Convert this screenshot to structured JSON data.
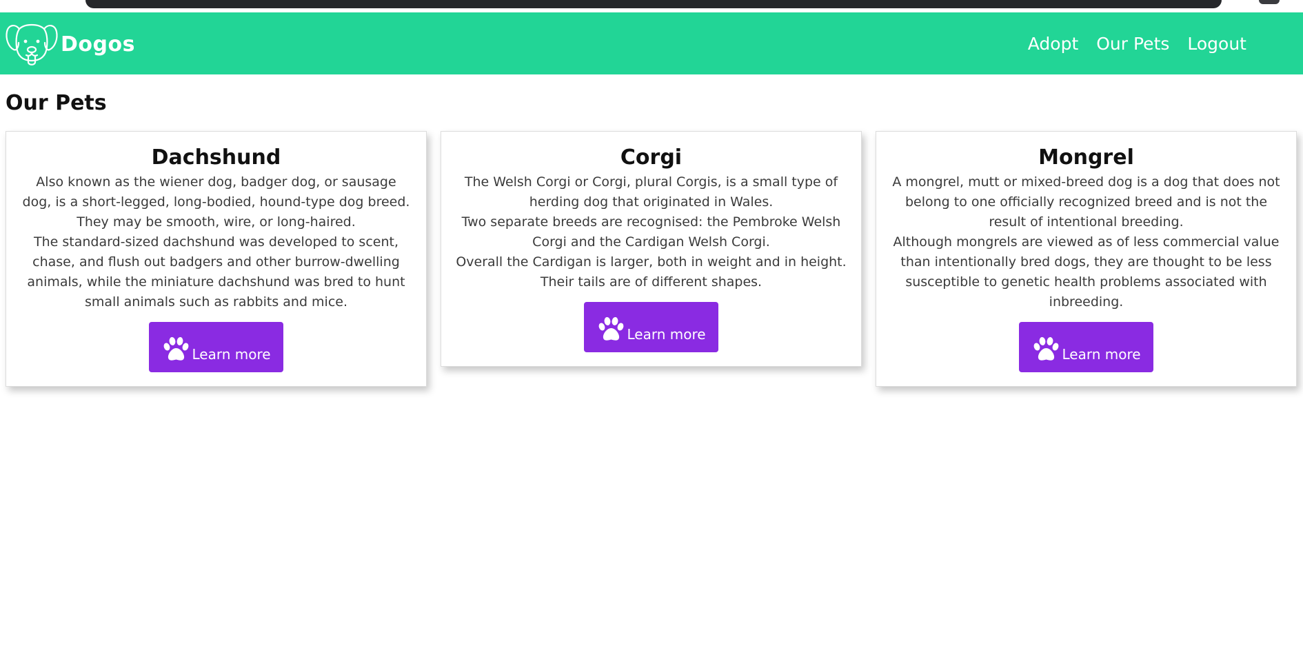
{
  "brand": {
    "name": "Dogos",
    "logo_icon": "dog-face-icon"
  },
  "nav": {
    "links": [
      {
        "label": "Adopt"
      },
      {
        "label": "Our Pets"
      },
      {
        "label": "Logout"
      }
    ]
  },
  "page": {
    "title": "Our Pets"
  },
  "cards": [
    {
      "title": "Dachshund",
      "paragraphs": [
        "Also known as the wiener dog, badger dog, or sausage dog, is a short-legged, long-bodied, hound-type dog breed. They may be smooth, wire, or long-haired.",
        "The standard-sized dachshund was developed to scent, chase, and flush out badgers and other burrow-dwelling animals, while the miniature dachshund was bred to hunt small animals such as rabbits and mice."
      ],
      "button_label": "Learn more"
    },
    {
      "title": "Corgi",
      "paragraphs": [
        "The Welsh Corgi or Corgi, plural Corgis, is a small type of herding dog that originated in Wales.",
        "Two separate breeds are recognised: the Pembroke Welsh Corgi and the Cardigan Welsh Corgi.",
        "Overall the Cardigan is larger, both in weight and in height. Their tails are of different shapes."
      ],
      "button_label": "Learn more"
    },
    {
      "title": "Mongrel",
      "paragraphs": [
        "A mongrel, mutt or mixed-breed dog is a dog that does not belong to one officially recognized breed and is not the result of intentional breeding.",
        "Although mongrels are viewed as of less commercial value than intentionally bred dogs, they are thought to be less susceptible to genetic health problems associated with inbreeding."
      ],
      "button_label": "Learn more"
    }
  ],
  "colors": {
    "navbar": "#22d596",
    "button": "#8a2be2",
    "text": "#3a3a3a"
  },
  "icons": {
    "button_icon": "paw-icon"
  }
}
